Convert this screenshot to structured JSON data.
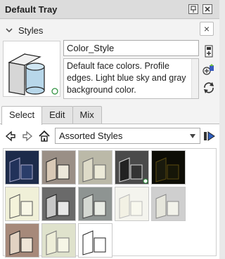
{
  "tray": {
    "title": "Default Tray",
    "pin_icon": "pin-icon",
    "close_icon": "close-icon"
  },
  "styles": {
    "section_label": "Styles",
    "close_glyph": "×",
    "style_name": "Color_Style",
    "description": "Default face colors. Profile edges. Light blue sky and gray background color.",
    "side_icons": [
      "create-new-style-icon",
      "update-style-icon",
      "refresh-icon"
    ]
  },
  "tabs": [
    {
      "label": "Select",
      "active": true
    },
    {
      "label": "Edit",
      "active": false
    },
    {
      "label": "Mix",
      "active": false
    }
  ],
  "browser": {
    "collection": "Assorted Styles",
    "nav_icons": [
      "back-icon",
      "forward-icon",
      "home-icon",
      "details-icon"
    ]
  },
  "colors": {
    "accent": "#7aa7d8",
    "panel_bg": "#f3f3f3",
    "header_bg": "#dcdcdc"
  }
}
